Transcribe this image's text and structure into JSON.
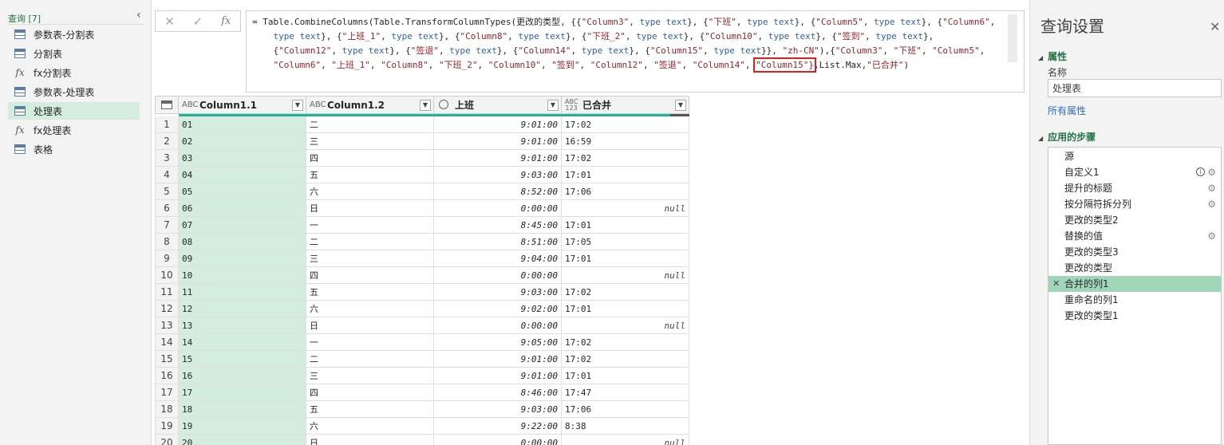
{
  "queries": {
    "header": "查询 [7]",
    "collapse_glyph": "‹",
    "items": [
      {
        "label": "参数表-分割表",
        "icon": "table-icon"
      },
      {
        "label": "分割表",
        "icon": "table-icon"
      },
      {
        "label": "fx分割表",
        "icon": "function-icon"
      },
      {
        "label": "参数表-处理表",
        "icon": "table-icon"
      },
      {
        "label": "处理表",
        "icon": "table-icon",
        "selected": true
      },
      {
        "label": "fx处理表",
        "icon": "function-icon"
      },
      {
        "label": "表格",
        "icon": "table-icon"
      }
    ]
  },
  "formula_bar": {
    "cancel_glyph": "✕",
    "confirm_glyph": "✓",
    "fx_label": "fx",
    "expand_glyph": "⌄"
  },
  "grid": {
    "columns": [
      {
        "name": "Column1.1",
        "type_label": "ABC"
      },
      {
        "name": "Column1.2",
        "type_label": "ABC"
      },
      {
        "name": "上班",
        "type_label": "clock"
      },
      {
        "name": "已合并",
        "type_label": "ABC123"
      }
    ],
    "rows": [
      [
        "1",
        "01",
        "二",
        "9:01:00",
        "17:02"
      ],
      [
        "2",
        "02",
        "三",
        "9:01:00",
        "16:59"
      ],
      [
        "3",
        "03",
        "四",
        "9:01:00",
        "17:02"
      ],
      [
        "4",
        "04",
        "五",
        "9:03:00",
        "17:01"
      ],
      [
        "5",
        "05",
        "六",
        "8:52:00",
        "17:06"
      ],
      [
        "6",
        "06",
        "日",
        "0:00:00",
        "null"
      ],
      [
        "7",
        "07",
        "一",
        "8:45:00",
        "17:01"
      ],
      [
        "8",
        "08",
        "二",
        "8:51:00",
        "17:05"
      ],
      [
        "9",
        "09",
        "三",
        "9:04:00",
        "17:01"
      ],
      [
        "10",
        "10",
        "四",
        "0:00:00",
        "null"
      ],
      [
        "11",
        "11",
        "五",
        "9:03:00",
        "17:02"
      ],
      [
        "12",
        "12",
        "六",
        "9:02:00",
        "17:01"
      ],
      [
        "13",
        "13",
        "日",
        "0:00:00",
        "null"
      ],
      [
        "14",
        "14",
        "一",
        "9:05:00",
        "17:02"
      ],
      [
        "15",
        "15",
        "二",
        "9:01:00",
        "17:02"
      ],
      [
        "16",
        "16",
        "三",
        "9:01:00",
        "17:01"
      ],
      [
        "17",
        "17",
        "四",
        "8:46:00",
        "17:47"
      ],
      [
        "18",
        "18",
        "五",
        "9:03:00",
        "17:06"
      ],
      [
        "19",
        "19",
        "六",
        "9:22:00",
        "8:38"
      ],
      [
        "20",
        "20",
        "日",
        "0:00:00",
        "null"
      ]
    ]
  },
  "settings": {
    "title": "查询设置",
    "close_glyph": "✕",
    "properties_section": "属性",
    "name_label": "名称",
    "name_value": "处理表",
    "all_properties_link": "所有属性",
    "steps_section": "应用的步骤",
    "steps": [
      {
        "label": "源",
        "gear": false,
        "info": false
      },
      {
        "label": "自定义1",
        "gear": true,
        "info": true
      },
      {
        "label": "提升的标题",
        "gear": true,
        "info": false
      },
      {
        "label": "按分隔符拆分列",
        "gear": true,
        "info": false
      },
      {
        "label": "更改的类型2",
        "gear": false,
        "info": false
      },
      {
        "label": "替换的值",
        "gear": true,
        "info": false
      },
      {
        "label": "更改的类型3",
        "gear": false,
        "info": false
      },
      {
        "label": "更改的类型",
        "gear": false,
        "info": false
      },
      {
        "label": "合并的列1",
        "gear": false,
        "info": false,
        "selected": true
      },
      {
        "label": "重命名的列1",
        "gear": false,
        "info": false
      },
      {
        "label": "更改的类型1",
        "gear": false,
        "info": false
      }
    ]
  },
  "colors": {
    "accent_green": "#217346",
    "selected_query_bg": "#d4eddf",
    "selected_step_bg": "#a2d6b8",
    "highlight_red": "#e81b1b",
    "keyword_blue": "#2e5fb2",
    "string_red": "#a01f27",
    "quality_bar": "#1fb39a"
  }
}
